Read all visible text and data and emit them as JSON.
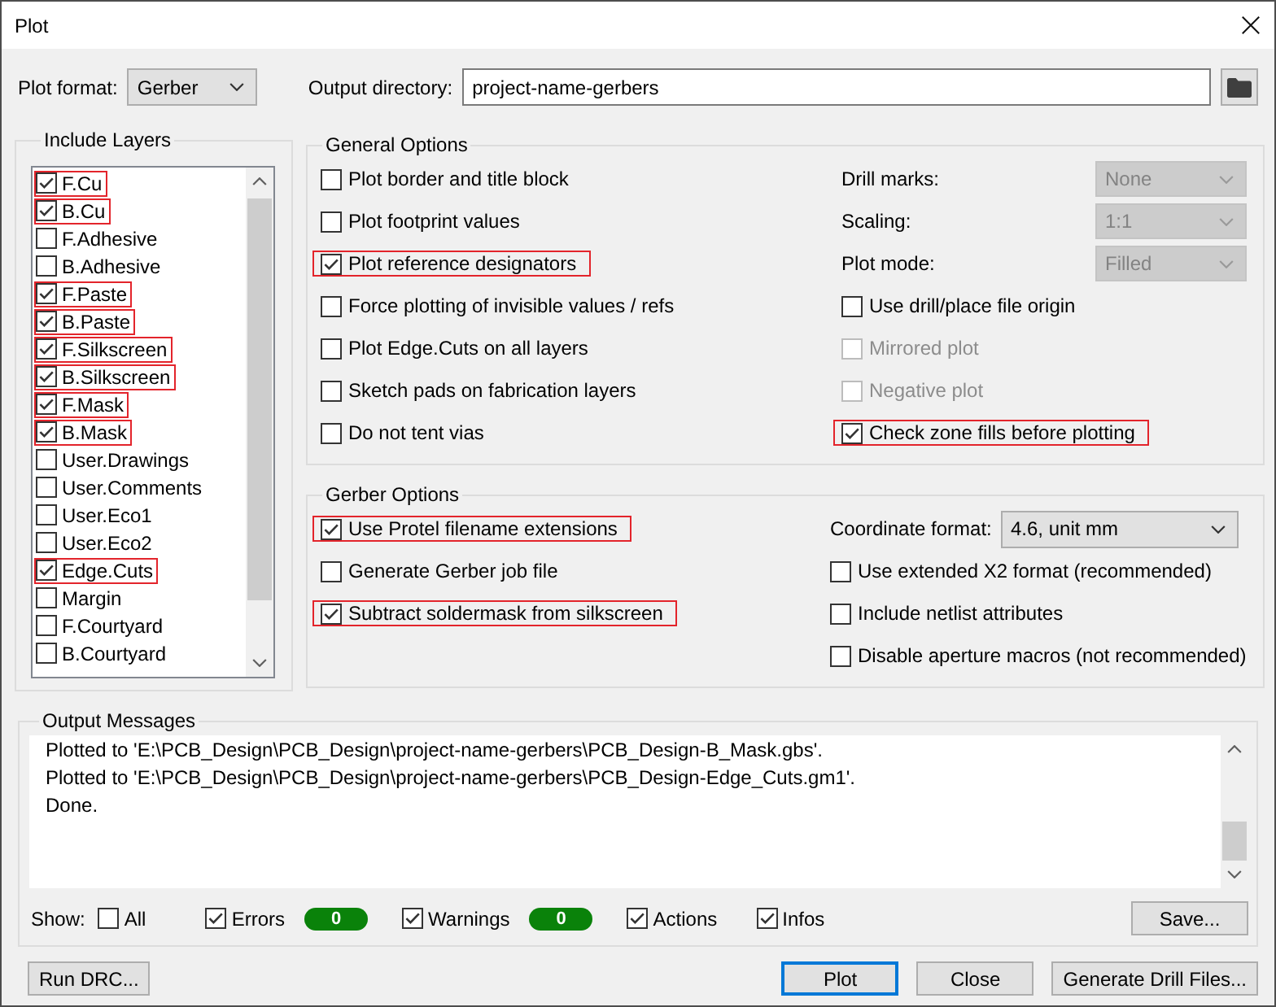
{
  "window": {
    "title": "Plot"
  },
  "plot_format": {
    "label": "Plot format:",
    "value": "Gerber"
  },
  "output_directory": {
    "label": "Output directory:",
    "value": "project-name-gerbers"
  },
  "include_layers": {
    "title": "Include Layers",
    "layers": [
      {
        "label": "F.Cu",
        "checked": true,
        "highlighted": true
      },
      {
        "label": "B.Cu",
        "checked": true,
        "highlighted": true
      },
      {
        "label": "F.Adhesive",
        "checked": false,
        "highlighted": false
      },
      {
        "label": "B.Adhesive",
        "checked": false,
        "highlighted": false
      },
      {
        "label": "F.Paste",
        "checked": true,
        "highlighted": true
      },
      {
        "label": "B.Paste",
        "checked": true,
        "highlighted": true
      },
      {
        "label": "F.Silkscreen",
        "checked": true,
        "highlighted": true
      },
      {
        "label": "B.Silkscreen",
        "checked": true,
        "highlighted": true
      },
      {
        "label": "F.Mask",
        "checked": true,
        "highlighted": true
      },
      {
        "label": "B.Mask",
        "checked": true,
        "highlighted": true
      },
      {
        "label": "User.Drawings",
        "checked": false,
        "highlighted": false
      },
      {
        "label": "User.Comments",
        "checked": false,
        "highlighted": false
      },
      {
        "label": "User.Eco1",
        "checked": false,
        "highlighted": false
      },
      {
        "label": "User.Eco2",
        "checked": false,
        "highlighted": false
      },
      {
        "label": "Edge.Cuts",
        "checked": true,
        "highlighted": true
      },
      {
        "label": "Margin",
        "checked": false,
        "highlighted": false
      },
      {
        "label": "F.Courtyard",
        "checked": false,
        "highlighted": false
      },
      {
        "label": "B.Courtyard",
        "checked": false,
        "highlighted": false
      }
    ]
  },
  "general_options": {
    "title": "General Options",
    "left": [
      {
        "label": "Plot border and title block",
        "checked": false,
        "highlighted": false
      },
      {
        "label": "Plot footprint values",
        "checked": false,
        "highlighted": false
      },
      {
        "label": "Plot reference designators",
        "checked": true,
        "highlighted": true
      },
      {
        "label": "Force plotting of invisible values / refs",
        "checked": false,
        "highlighted": false
      },
      {
        "label": "Plot Edge.Cuts on all layers",
        "checked": false,
        "highlighted": false
      },
      {
        "label": "Sketch pads on fabrication layers",
        "checked": false,
        "highlighted": false
      },
      {
        "label": "Do not tent vias",
        "checked": false,
        "highlighted": false
      }
    ],
    "right": [
      {
        "kind": "select",
        "label": "Drill marks:",
        "value": "None",
        "disabled": true
      },
      {
        "kind": "select",
        "label": "Scaling:",
        "value": "1:1",
        "disabled": true
      },
      {
        "kind": "select",
        "label": "Plot mode:",
        "value": "Filled",
        "disabled": true
      },
      {
        "kind": "checkbox",
        "label": "Use drill/place file origin",
        "checked": false,
        "disabled": false,
        "highlighted": false
      },
      {
        "kind": "checkbox",
        "label": "Mirrored plot",
        "checked": false,
        "disabled": true,
        "highlighted": false
      },
      {
        "kind": "checkbox",
        "label": "Negative plot",
        "checked": false,
        "disabled": true,
        "highlighted": false
      },
      {
        "kind": "checkbox",
        "label": "Check zone fills before plotting",
        "checked": true,
        "disabled": false,
        "highlighted": true
      }
    ]
  },
  "gerber_options": {
    "title": "Gerber Options",
    "left": [
      {
        "label": "Use Protel filename extensions",
        "checked": true,
        "highlighted": true
      },
      {
        "label": "Generate Gerber job file",
        "checked": false,
        "highlighted": false
      },
      {
        "label": "Subtract soldermask from silkscreen",
        "checked": true,
        "highlighted": true
      }
    ],
    "right": [
      {
        "kind": "select",
        "label": "Coordinate format:",
        "value": "4.6, unit mm"
      },
      {
        "kind": "checkbox",
        "label": "Use extended X2 format (recommended)",
        "checked": false,
        "highlighted": false
      },
      {
        "kind": "checkbox",
        "label": "Include netlist attributes",
        "checked": false,
        "highlighted": false
      },
      {
        "kind": "checkbox",
        "label": "Disable aperture macros (not recommended)",
        "checked": false,
        "highlighted": false
      }
    ]
  },
  "output_messages": {
    "title": "Output Messages",
    "lines": [
      "Plotted to 'E:\\PCB_Design\\PCB_Design\\project-name-gerbers\\PCB_Design-B_Mask.gbs'.",
      "Plotted to 'E:\\PCB_Design\\PCB_Design\\project-name-gerbers\\PCB_Design-Edge_Cuts.gm1'.",
      "Done."
    ],
    "show_label": "Show:",
    "filters": [
      {
        "label": "All",
        "checked": false
      },
      {
        "label": "Errors",
        "checked": true,
        "count": "0"
      },
      {
        "label": "Warnings",
        "checked": true,
        "count": "0"
      },
      {
        "label": "Actions",
        "checked": true
      },
      {
        "label": "Infos",
        "checked": true
      }
    ],
    "save_button": "Save..."
  },
  "buttons": {
    "left": [
      {
        "label": "Run DRC...",
        "default": false
      }
    ],
    "right": [
      {
        "label": "Plot",
        "default": true
      },
      {
        "label": "Close",
        "default": false
      },
      {
        "label": "Generate Drill Files...",
        "default": false
      }
    ]
  }
}
